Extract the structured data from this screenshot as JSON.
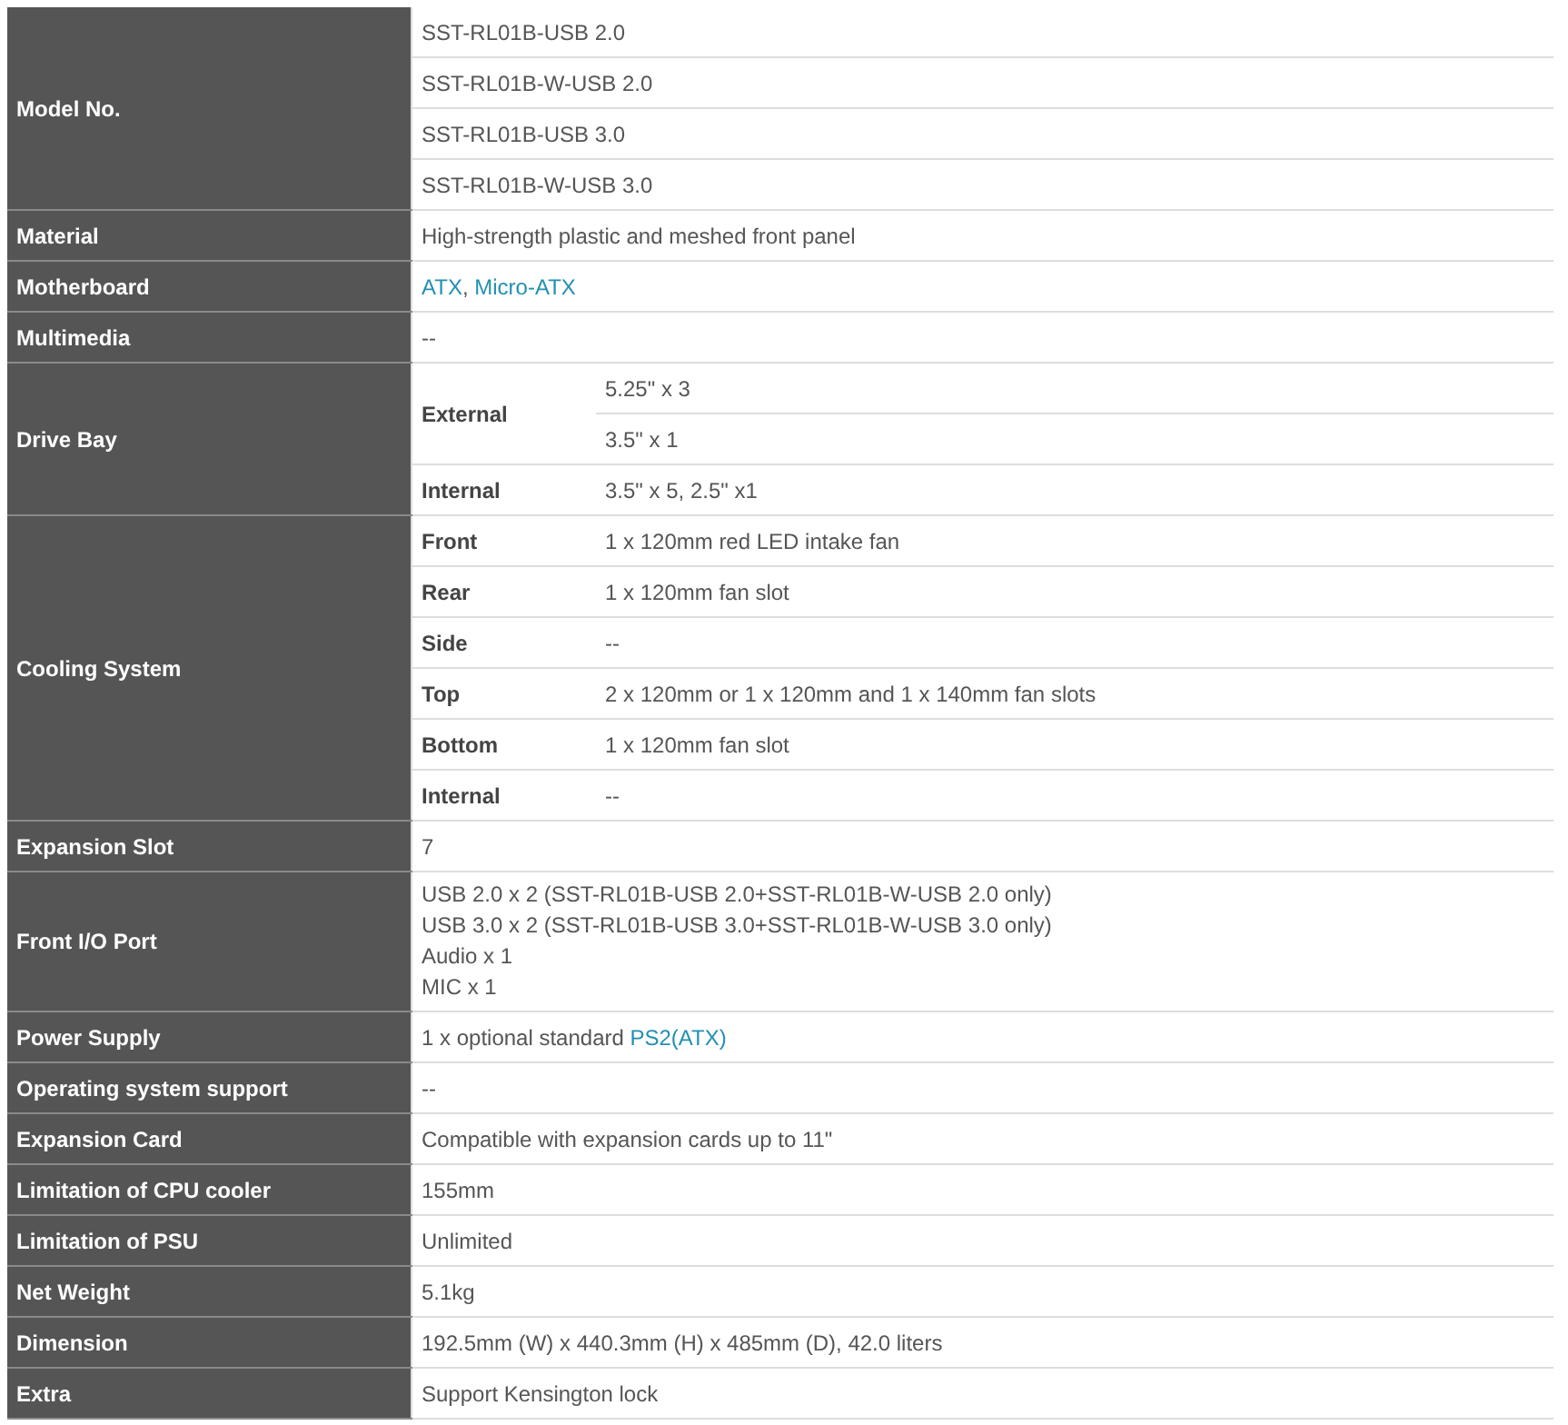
{
  "specs": [
    {
      "label": "Model No.",
      "kind": "lines",
      "values": [
        "SST-RL01B-USB 2.0",
        "SST-RL01B-W-USB 2.0",
        "SST-RL01B-USB 3.0",
        "SST-RL01B-W-USB 3.0"
      ]
    },
    {
      "label": "Material",
      "kind": "lines",
      "values": [
        "High-strength plastic and meshed front panel"
      ]
    },
    {
      "label": "Motherboard",
      "kind": "parts",
      "parts": [
        {
          "text": "ATX",
          "link": true
        },
        {
          "text": ", ",
          "link": false
        },
        {
          "text": "Micro-ATX",
          "link": true
        }
      ]
    },
    {
      "label": "Multimedia",
      "kind": "lines",
      "values": [
        "--"
      ]
    },
    {
      "label": "Drive Bay",
      "kind": "sub",
      "subs": [
        {
          "label": "External",
          "values": [
            "5.25\" x 3",
            "3.5\" x 1"
          ]
        },
        {
          "label": "Internal",
          "values": [
            "3.5\" x 5, 2.5\" x1"
          ]
        }
      ]
    },
    {
      "label": "Cooling System",
      "kind": "sub",
      "subs": [
        {
          "label": "Front",
          "values": [
            "1 x 120mm red LED intake fan"
          ]
        },
        {
          "label": "Rear",
          "values": [
            "1 x 120mm fan slot"
          ]
        },
        {
          "label": "Side",
          "values": [
            "--"
          ]
        },
        {
          "label": "Top",
          "values": [
            "2 x 120mm or 1 x 120mm and 1 x 140mm fan slots"
          ]
        },
        {
          "label": "Bottom",
          "values": [
            "1 x 120mm fan slot"
          ]
        },
        {
          "label": "Internal",
          "values": [
            "--"
          ]
        }
      ]
    },
    {
      "label": "Expansion Slot",
      "kind": "lines",
      "values": [
        "7"
      ]
    },
    {
      "label": "Front I/O Port",
      "kind": "multiline",
      "values": [
        "USB 2.0 x 2 (SST-RL01B-USB 2.0+SST-RL01B-W-USB 2.0 only)",
        "USB 3.0 x 2 (SST-RL01B-USB 3.0+SST-RL01B-W-USB 3.0 only)",
        "Audio x 1",
        "MIC x 1"
      ]
    },
    {
      "label": "Power Supply",
      "kind": "parts",
      "parts": [
        {
          "text": "1 x optional standard ",
          "link": false
        },
        {
          "text": "PS2(ATX)",
          "link": true
        }
      ]
    },
    {
      "label": "Operating system support",
      "kind": "lines",
      "values": [
        "--"
      ]
    },
    {
      "label": "Expansion Card",
      "kind": "lines",
      "values": [
        "Compatible with expansion cards up to 11\""
      ]
    },
    {
      "label": "Limitation of CPU cooler",
      "kind": "lines",
      "values": [
        "155mm"
      ]
    },
    {
      "label": "Limitation of PSU",
      "kind": "lines",
      "values": [
        "Unlimited"
      ]
    },
    {
      "label": "Net Weight",
      "kind": "lines",
      "values": [
        "5.1kg"
      ]
    },
    {
      "label": "Dimension",
      "kind": "lines",
      "values": [
        "192.5mm (W) x 440.3mm (H) x 485mm (D), 42.0 liters"
      ]
    },
    {
      "label": "Extra",
      "kind": "lines",
      "values": [
        "Support Kensington lock"
      ]
    }
  ]
}
